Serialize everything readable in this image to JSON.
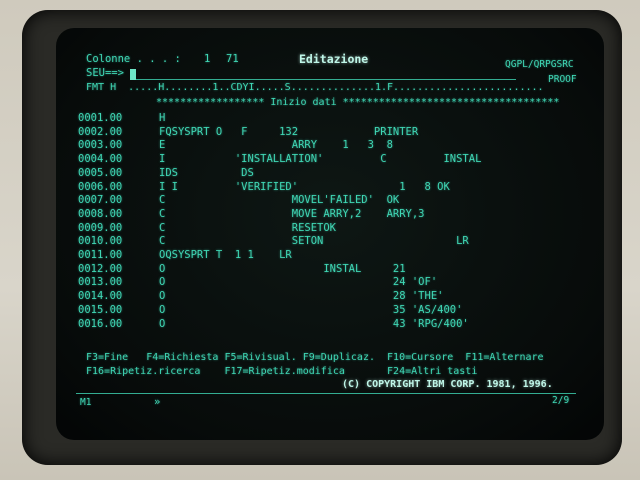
{
  "header": {
    "colonne_label": "Colonne . . . :",
    "colonne_from": "1",
    "colonne_to": "71",
    "title": "Editazione",
    "member": "QGPL/QRPGSRC",
    "seu_prompt": "SEU==>",
    "member_name": "PROOF"
  },
  "format_ruler": "FMT H  .....H........1..CDYI.....S..............1.F.........................",
  "top_of_data": "****************** Inizio dati ************************************",
  "source_lines": [
    {
      "seq": "0001.00",
      "code": "H"
    },
    {
      "seq": "0002.00",
      "code": "FQSYSPRT O   F     132            PRINTER"
    },
    {
      "seq": "0003.00",
      "code": "E                    ARRY    1   3  8"
    },
    {
      "seq": "0004.00",
      "code": "I           'INSTALLATION'         C         INSTAL"
    },
    {
      "seq": "0005.00",
      "code": "IDS          DS"
    },
    {
      "seq": "0006.00",
      "code": "I I         'VERIFIED'                1   8 OK"
    },
    {
      "seq": "0007.00",
      "code": "C                    MOVEL'FAILED'  OK"
    },
    {
      "seq": "0008.00",
      "code": "C                    MOVE ARRY,2    ARRY,3"
    },
    {
      "seq": "0009.00",
      "code": "C                    RESETOK"
    },
    {
      "seq": "0010.00",
      "code": "C                    SETON                     LR"
    },
    {
      "seq": "0011.00",
      "code": "OQSYSPRT T  1 1    LR"
    },
    {
      "seq": "0012.00",
      "code": "O                         INSTAL     21"
    },
    {
      "seq": "0013.00",
      "code": "O                                    24 'OF'"
    },
    {
      "seq": "0014.00",
      "code": "O                                    28 'THE'"
    },
    {
      "seq": "0015.00",
      "code": "O                                    35 'AS/400'"
    },
    {
      "seq": "0016.00",
      "code": "O                                    43 'RPG/400'"
    }
  ],
  "function_keys": {
    "line1": "F3=Fine   F4=Richiesta F5=Rivisual. F9=Duplicaz.  F10=Cursore  F11=Alternare",
    "line2": "F16=Ripetiz.ricerca    F17=Ripetiz.modifica       F24=Altri tasti"
  },
  "copyright": "(C) COPYRIGHT IBM CORP. 1981, 1996.",
  "status": {
    "left": "M1",
    "indicator": "»",
    "page": "2/9"
  }
}
